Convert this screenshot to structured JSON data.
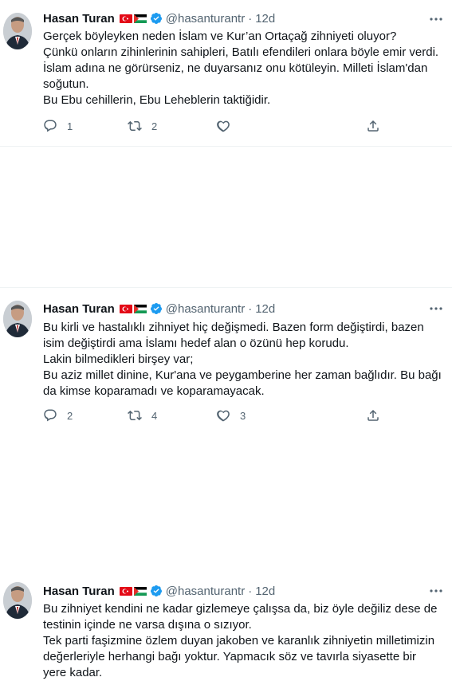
{
  "author": {
    "name": "Hasan Turan",
    "handle": "@hasanturantr",
    "time": "12d",
    "flags": [
      "turkey-flag",
      "palestine-flag"
    ],
    "verified_icon": "verified-badge-icon",
    "accent": "#1d9bf0"
  },
  "tweets": [
    {
      "text": "Gerçek böyleyken neden İslam ve Kur’an Ortaçağ zihniyeti oluyor?\nÇünkü onların zihinlerinin sahipleri, Batılı efendileri onlara böyle emir verdi.\nİslam adına ne görürseniz, ne duyarsanız onu kötüleyin. Milleti İslam'dan soğutun.\nBu Ebu cehillerin, Ebu Leheblerin taktiğidir.",
      "replies": "1",
      "retweets": "2",
      "likes": ""
    },
    {
      "text": "Bu kirli ve hastalıklı zihniyet hiç değişmedi. Bazen form değiştirdi, bazen isim değiştirdi ama İslamı hedef alan o özünü hep korudu.\nLakin bilmedikleri birşey var;\nBu aziz millet dinine, Kur'ana ve peygamberine her zaman bağlıdır. Bu bağı da kimse koparamadı ve koparamayacak.",
      "replies": "2",
      "retweets": "4",
      "likes": "3"
    },
    {
      "text": "Bu zihniyet kendini ne kadar gizlemeye çalışsa da, biz öyle değiliz dese de testinin içinde ne varsa dışına o sızıyor.\nTek parti faşizmine özlem duyan jakoben ve karanlık zihniyetin milletimizin değerleriyle herhangi bağı yoktur. Yapmacık söz ve tavırla siyasette bir yere kadar."
    }
  ],
  "icons": [
    "reply-icon",
    "retweet-icon",
    "like-icon",
    "share-icon",
    "more-icon"
  ]
}
